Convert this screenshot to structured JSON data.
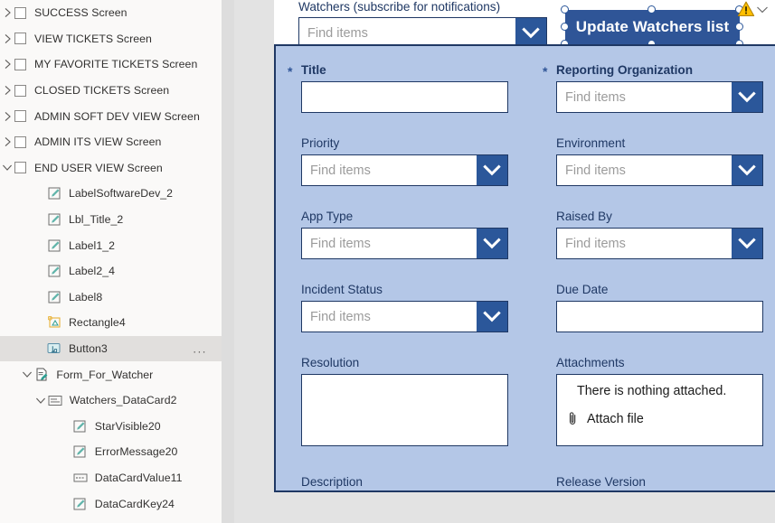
{
  "tree": {
    "items": [
      {
        "label": "SUCCESS Screen",
        "type": "screen",
        "indent": 0,
        "chevron": "right",
        "checkbox": true,
        "icon": "screen-checkbox",
        "selected": false,
        "ellipsis": false
      },
      {
        "label": "VIEW TICKETS Screen",
        "type": "screen",
        "indent": 0,
        "chevron": "right",
        "checkbox": true,
        "icon": "screen-checkbox",
        "selected": false,
        "ellipsis": false
      },
      {
        "label": "MY FAVORITE TICKETS Screen",
        "type": "screen",
        "indent": 0,
        "chevron": "right",
        "checkbox": true,
        "icon": "screen-checkbox",
        "selected": false,
        "ellipsis": false
      },
      {
        "label": "CLOSED TICKETS Screen",
        "type": "screen",
        "indent": 0,
        "chevron": "right",
        "checkbox": true,
        "icon": "screen-checkbox",
        "selected": false,
        "ellipsis": false
      },
      {
        "label": "ADMIN SOFT DEV VIEW Screen",
        "type": "screen",
        "indent": 0,
        "chevron": "right",
        "checkbox": true,
        "icon": "screen-checkbox",
        "selected": false,
        "ellipsis": false
      },
      {
        "label": "ADMIN ITS VIEW Screen",
        "type": "screen",
        "indent": 0,
        "chevron": "right",
        "checkbox": true,
        "icon": "screen-checkbox",
        "selected": false,
        "ellipsis": false
      },
      {
        "label": "END USER VIEW Screen",
        "type": "screen",
        "indent": 0,
        "chevron": "down",
        "checkbox": true,
        "icon": "screen-checkbox",
        "selected": false,
        "ellipsis": false
      },
      {
        "label": "LabelSoftwareDev_2",
        "type": "control",
        "indent": 1,
        "chevron": "none",
        "checkbox": false,
        "icon": "label-icon",
        "selected": false,
        "ellipsis": false
      },
      {
        "label": "Lbl_Title_2",
        "type": "control",
        "indent": 1,
        "chevron": "none",
        "checkbox": false,
        "icon": "label-icon",
        "selected": false,
        "ellipsis": false
      },
      {
        "label": "Label1_2",
        "type": "control",
        "indent": 1,
        "chevron": "none",
        "checkbox": false,
        "icon": "label-icon",
        "selected": false,
        "ellipsis": false
      },
      {
        "label": "Label2_4",
        "type": "control",
        "indent": 1,
        "chevron": "none",
        "checkbox": false,
        "icon": "label-icon",
        "selected": false,
        "ellipsis": false
      },
      {
        "label": "Label8",
        "type": "control",
        "indent": 1,
        "chevron": "none",
        "checkbox": false,
        "icon": "label-icon",
        "selected": false,
        "ellipsis": false
      },
      {
        "label": "Rectangle4",
        "type": "control",
        "indent": 1,
        "chevron": "none",
        "checkbox": false,
        "icon": "rectangle-icon",
        "selected": false,
        "ellipsis": false
      },
      {
        "label": "Button3",
        "type": "control",
        "indent": 1,
        "chevron": "none",
        "checkbox": false,
        "icon": "button-icon",
        "selected": true,
        "ellipsis": true
      },
      {
        "label": "Form_For_Watcher",
        "type": "control",
        "indent": 0.6,
        "chevron": "down",
        "checkbox": false,
        "icon": "form-icon",
        "selected": false,
        "ellipsis": false
      },
      {
        "label": "Watchers_DataCard2",
        "type": "control",
        "indent": 1.2,
        "chevron": "down",
        "checkbox": false,
        "icon": "datacard-icon",
        "selected": false,
        "ellipsis": false
      },
      {
        "label": "StarVisible20",
        "type": "control",
        "indent": 2.2,
        "chevron": "none",
        "checkbox": false,
        "icon": "label-icon",
        "selected": false,
        "ellipsis": false
      },
      {
        "label": "ErrorMessage20",
        "type": "control",
        "indent": 2.2,
        "chevron": "none",
        "checkbox": false,
        "icon": "label-icon",
        "selected": false,
        "ellipsis": false
      },
      {
        "label": "DataCardValue11",
        "type": "control",
        "indent": 2.2,
        "chevron": "none",
        "checkbox": false,
        "icon": "combobox-icon",
        "selected": false,
        "ellipsis": false
      },
      {
        "label": "DataCardKey24",
        "type": "control",
        "indent": 2.2,
        "chevron": "none",
        "checkbox": false,
        "icon": "label-icon",
        "selected": false,
        "ellipsis": false
      }
    ],
    "overflow_label": "..."
  },
  "canvas": {
    "watchers": {
      "label": "Watchers (subscribe for notifications)",
      "placeholder": "Find items",
      "value": ""
    },
    "update_button": {
      "label": "Update Watchers list",
      "selected": true,
      "warning": true
    },
    "form": {
      "fields": [
        {
          "key": "title",
          "label": "Title",
          "required": true,
          "control": "text",
          "placeholder": "",
          "value": ""
        },
        {
          "key": "reporting_org",
          "label": "Reporting Organization",
          "required": true,
          "control": "combo",
          "placeholder": "Find items",
          "value": ""
        },
        {
          "key": "priority",
          "label": "Priority",
          "required": false,
          "control": "combo",
          "placeholder": "Find items",
          "value": ""
        },
        {
          "key": "environment",
          "label": "Environment",
          "required": false,
          "control": "combo",
          "placeholder": "Find items",
          "value": ""
        },
        {
          "key": "app_type",
          "label": "App Type",
          "required": false,
          "control": "combo",
          "placeholder": "Find items",
          "value": ""
        },
        {
          "key": "raised_by",
          "label": "Raised By",
          "required": false,
          "control": "combo",
          "placeholder": "Find items",
          "value": ""
        },
        {
          "key": "incident_status",
          "label": "Incident Status",
          "required": false,
          "control": "combo",
          "placeholder": "Find items",
          "value": ""
        },
        {
          "key": "due_date",
          "label": "Due Date",
          "required": false,
          "control": "text",
          "placeholder": "",
          "value": ""
        },
        {
          "key": "resolution",
          "label": "Resolution",
          "required": false,
          "control": "textarea",
          "placeholder": "",
          "value": ""
        },
        {
          "key": "attachments",
          "label": "Attachments",
          "required": false,
          "control": "attach",
          "placeholder": "",
          "value": ""
        },
        {
          "key": "description",
          "label": "Description",
          "required": false,
          "control": "label-only",
          "placeholder": "",
          "value": ""
        },
        {
          "key": "release_version",
          "label": "Release Version",
          "required": false,
          "control": "label-only",
          "placeholder": "",
          "value": ""
        }
      ],
      "attachments": {
        "empty_text": "There is nothing attached.",
        "attach_label": "Attach file"
      },
      "required_marker": "*"
    }
  },
  "colors": {
    "form_background": "#b4c7e7",
    "form_border": "#1f3864",
    "accent_blue": "#2b579a",
    "button_blue": "#2f5597",
    "label_text": "#1f3864",
    "placeholder_text": "#9b9b9b",
    "warning_yellow": "#ffc000",
    "tree_selected": "#e1dfdd",
    "tree_background": "#faf9f8",
    "gutter_gray": "#e3e3e3"
  }
}
